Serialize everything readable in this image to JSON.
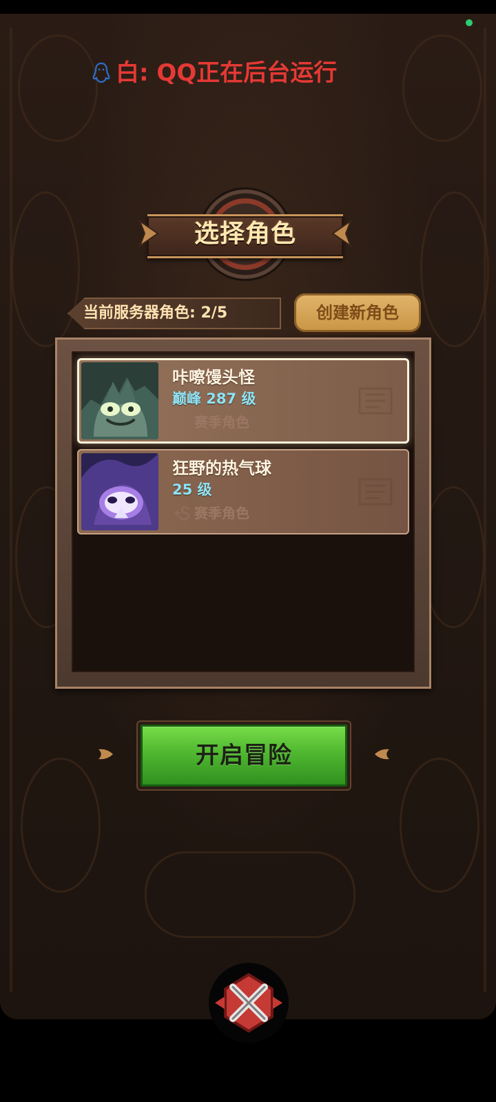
{
  "status": {
    "indicator_color": "#2ecc71"
  },
  "notice": {
    "icon": "qq-penguin-icon",
    "text": "白: QQ正在后台运行",
    "color": "#e53935"
  },
  "title": {
    "text": "选择角色"
  },
  "server": {
    "label": "当前服务器角色:",
    "count": "2/5"
  },
  "create_button": {
    "label": "创建新角色"
  },
  "characters": [
    {
      "name": "咔嚓馒头怪",
      "level": "巅峰 287 级",
      "season": "赛季角色",
      "selected": true,
      "portrait": "green-demon-portrait"
    },
    {
      "name": "狂野的热气球",
      "level": "25 级",
      "season": "赛季角色",
      "selected": false,
      "portrait": "purple-wizard-portrait"
    }
  ],
  "start_button": {
    "label": "开启冒险"
  },
  "logo": {
    "icon": "crossed-swords-logo"
  }
}
